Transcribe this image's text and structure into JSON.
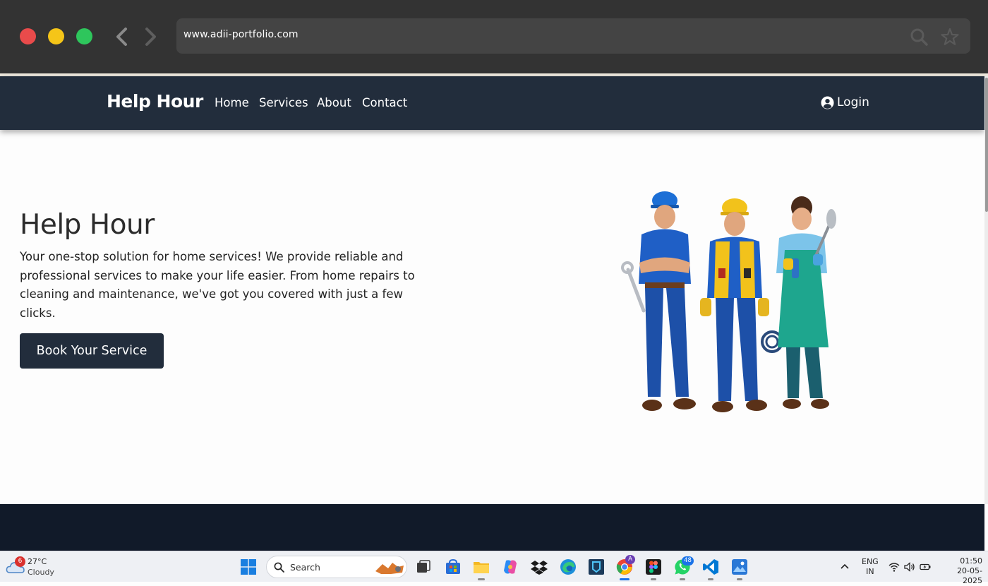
{
  "browser": {
    "url": "www.adii-portfolio.com",
    "icons": [
      "back-arrow-icon",
      "forward-arrow-icon",
      "search-icon",
      "star-icon"
    ],
    "traffic_lights": {
      "close": "#e94b4b",
      "minimize": "#f5c518",
      "maximize": "#2ec65c"
    }
  },
  "site": {
    "brand": "Help Hour",
    "nav": {
      "home": "Home",
      "services": "Services",
      "about": "About",
      "contact": "Contact"
    },
    "login": "Login",
    "colors": {
      "header": "#222d3c",
      "footer": "#111a29",
      "button": "#222d3c"
    }
  },
  "hero": {
    "title": "Help Hour",
    "description": "Your one-stop solution for home services! We provide reliable and professional services to make your life easier. From home repairs to cleaning and maintenance, we've got you covered with just a few clicks.",
    "cta": "Book Your Service",
    "illustration": "three-workers-illustration"
  },
  "taskbar": {
    "weather": {
      "badge": "6",
      "temp": "27°C",
      "condition": "Cloudy"
    },
    "search_label": "Search",
    "apps": [
      "start-icon",
      "task-view-icon",
      "microsoft-store-icon",
      "file-explorer-icon",
      "copilot-icon",
      "dropbox-icon",
      "edge-icon",
      "app-icon",
      "chrome-icon",
      "figma-icon",
      "whatsapp-icon",
      "vscode-icon",
      "photos-icon"
    ],
    "chrome_badge": "A",
    "whatsapp_badge": "48",
    "lang_top": "ENG",
    "lang_bottom": "IN",
    "time": "01:50",
    "date": "20-05-2025"
  }
}
